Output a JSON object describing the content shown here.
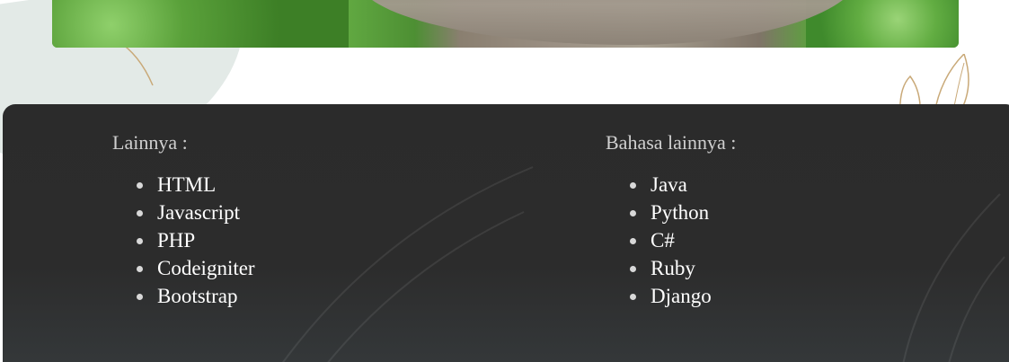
{
  "footer": {
    "left_column": {
      "title": "Lainnya :",
      "items": [
        "HTML",
        "Javascript",
        "PHP",
        "Codeigniter",
        "Bootstrap"
      ]
    },
    "right_column": {
      "title": "Bahasa lainnya :",
      "items": [
        "Java",
        "Python",
        "C#",
        "Ruby",
        "Django"
      ]
    }
  },
  "colors": {
    "footer_background": "#2b2b2b",
    "title_text": "#cfcfcf",
    "item_text": "#ffffff",
    "accent_leaf": "#c9a978"
  },
  "images": {
    "hero": "tree-branch-photo",
    "decoration": "leaf-outline-icon"
  }
}
